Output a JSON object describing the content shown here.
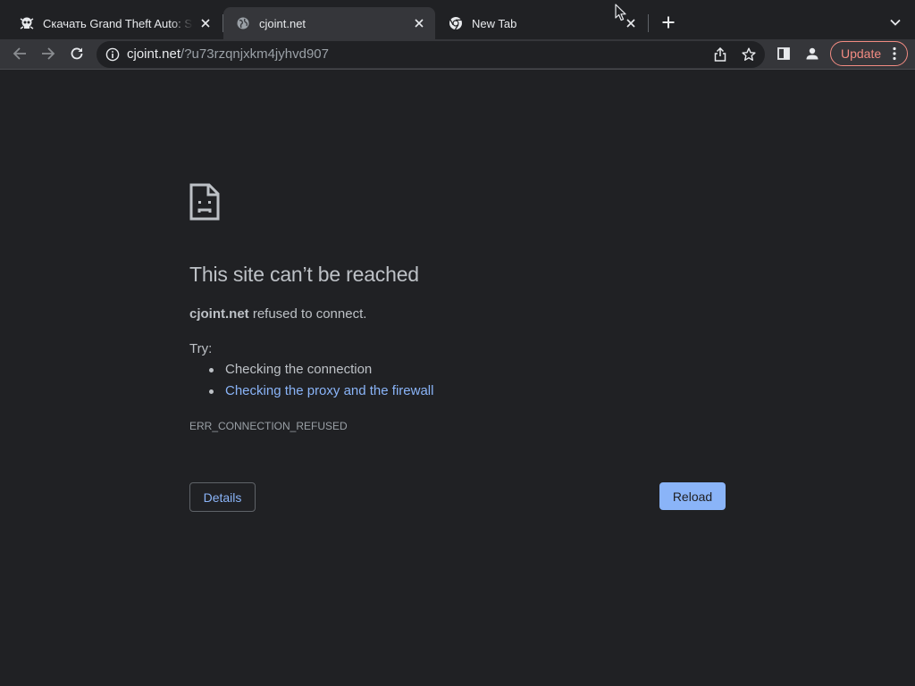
{
  "browser": {
    "tabs": [
      {
        "title": "Скачать Grand Theft Auto: San Andreas",
        "favicon": "skull-icon",
        "active": false
      },
      {
        "title": "cjoint.net",
        "favicon": "globe-icon",
        "active": true
      },
      {
        "title": "New Tab",
        "favicon": "chrome-icon",
        "active": false
      }
    ],
    "new_tab_icon": "plus-icon",
    "tab_search_icon": "chevron-down-icon"
  },
  "toolbar": {
    "back_icon": "arrow-left-icon",
    "forward_icon": "arrow-right-icon",
    "reload_icon": "reload-icon",
    "url_host": "cjoint.net",
    "url_path": "/?u73rzqnjxkm4jyhvd907",
    "update_label": "Update"
  },
  "error_page": {
    "title": "This site can’t be reached",
    "detail_host": "cjoint.net",
    "detail_text": " refused to connect.",
    "try_label": "Try:",
    "suggestions": [
      {
        "text": "Checking the connection",
        "is_link": false
      },
      {
        "text": "Checking the proxy and the firewall",
        "is_link": true
      }
    ],
    "error_code": "ERR_CONNECTION_REFUSED",
    "details_button": "Details",
    "reload_button": "Reload"
  },
  "colors": {
    "background": "#202124",
    "toolbar": "#35363a",
    "link": "#8ab4f8",
    "update_accent": "#f28b82"
  }
}
